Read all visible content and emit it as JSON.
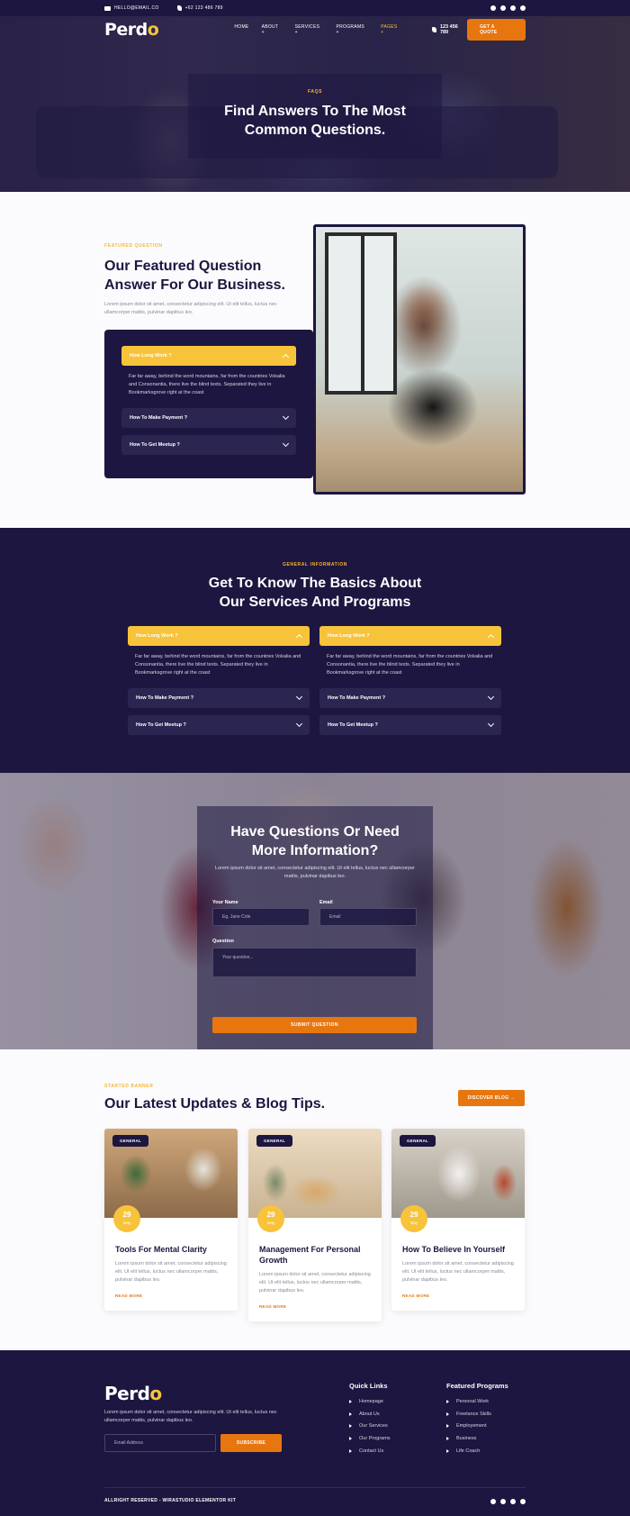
{
  "topbar": {
    "email": "HELLO@EMAIL.CO",
    "phone": "+62 123 486 789"
  },
  "nav": {
    "logo_a": "Perd",
    "logo_b": "o",
    "items": [
      "HOME",
      "ABOUT +",
      "SERVICES +",
      "PROGRAMS +",
      "PAGES +"
    ],
    "phone": "123 456 789",
    "cta": "GET A QUOTE"
  },
  "hero": {
    "eyebrow": "FAQS",
    "title_l1": "Find Answers To The Most",
    "title_l2": "Common Questions."
  },
  "featured": {
    "eyebrow": "FEATURED QUESTION",
    "title_l1": "Our Featured Question",
    "title_l2": "Answer For Our Business.",
    "text": "Lorem ipsum dolor sit amet, consectetur adipiscing elit. Ut elit tellus, luctus nec ullamcorper mattis, pulvinar dapibus leo.",
    "faq": [
      {
        "q": "How Long Work ?",
        "a": "Far far away, behind the word mountains, far from the countries Vokalia and Consonantia, there live the blind texts. Separated they live in Bookmarksgrove right at the coast"
      },
      {
        "q": "How To Make Payment ?"
      },
      {
        "q": "How To Get Meetup ?"
      }
    ]
  },
  "general": {
    "eyebrow": "GENERAL INFORMATION",
    "title_l1": "Get To Know The Basics About",
    "title_l2": "Our Services And Programs",
    "left": [
      {
        "q": "How Long Work ?",
        "a": "Far far away, behind the word mountains, far from the countries Vokalia and Consonantia, there live the blind texts. Separated they live in Bookmarksgrove right at the coast"
      },
      {
        "q": "How To Make Payment ?"
      },
      {
        "q": "How To Get Meetup ?"
      }
    ],
    "right": [
      {
        "q": "How Long Work ?",
        "a": "Far far away, behind the word mountains, far from the countries Vokalia and Consonantia, there live the blind texts. Separated they live in Bookmarksgrove right at the coast"
      },
      {
        "q": "How To Make Payment ?"
      },
      {
        "q": "How To Get Meetup ?"
      }
    ]
  },
  "contact": {
    "title_l1": "Have Questions Or Need",
    "title_l2": "More Information?",
    "text": "Lorem ipsum dolor sit amet, consectetur adipiscing elit. Ut elit tellus, luctus nec ullamcorper mattis, pulvinar dapibus leo.",
    "name_label": "Your Name",
    "name_placeholder": "Eg. Jane Cole",
    "email_label": "Email",
    "email_placeholder": "Email",
    "question_label": "Question",
    "question_placeholder": "Your question...",
    "submit": "SUBMIT QUESTION"
  },
  "blog": {
    "eyebrow": "STARTED BANNER",
    "title": "Our Latest Updates & Blog Tips.",
    "discover": "DISCOVER BLOG →",
    "posts": [
      {
        "tag": "GENERAL",
        "day": "29",
        "month": "May",
        "title": "Tools For Mental Clarity",
        "text": "Lorem ipsum dolor sit amet, consectetur adipiscing elit. Ut elit tellus, luctus nec ullamcorper mattis, pulvinar dapibus leo.",
        "more": "READ MORE"
      },
      {
        "tag": "GENERAL",
        "day": "29",
        "month": "May",
        "title": "Management For Personal Growth",
        "text": "Lorem ipsum dolor sit amet, consectetur adipiscing elit. Ut elit tellus, luctus nec ullamcorper mattis, pulvinar dapibus leo.",
        "more": "READ MORE"
      },
      {
        "tag": "GENERAL",
        "day": "29",
        "month": "May",
        "title": "How To Believe In Yourself",
        "text": "Lorem ipsum dolor sit amet, consectetur adipiscing elit. Ut elit tellus, luctus nec ullamcorper mattis, pulvinar dapibus leo.",
        "more": "READ MORE"
      }
    ]
  },
  "footer": {
    "logo_a": "Perd",
    "logo_b": "o",
    "text": "Lorem ipsum dolor sit amet, consectetur adipiscing elit. Ut elit tellus, luctus nec ullamcorper mattis, pulvinar dapibus leo.",
    "email_placeholder": "Email Address",
    "subscribe": "SUBSCRIBE",
    "quick_title": "Quick Links",
    "quick": [
      "Homepage",
      "About Us",
      "Our Services",
      "Our Programs",
      "Contact Us"
    ],
    "programs_title": "Featured Programs",
    "programs": [
      "Personal Work",
      "Freelance Skills",
      "Employement",
      "Business",
      "Life Coach"
    ],
    "copyright": "ALLRIGHT RESERVED - WIRASTUDIO ELEMENTOR KIT"
  },
  "colors": {
    "navy": "#1c1640",
    "accent_orange": "#e8760f",
    "accent_yellow": "#f7c33b"
  }
}
